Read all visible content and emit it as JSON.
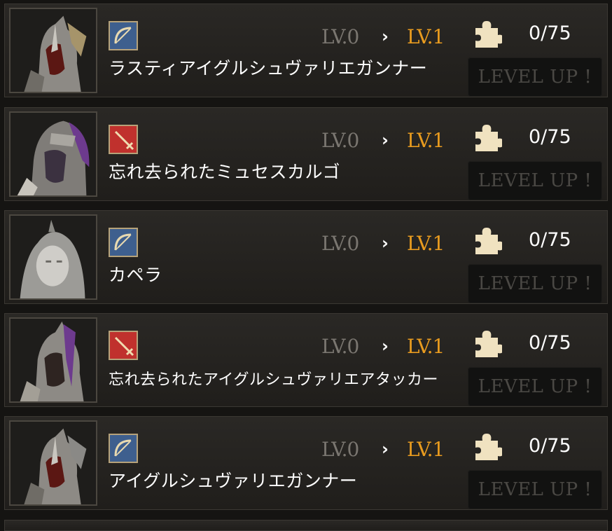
{
  "items": [
    {
      "name": "ラスティアイグルシュヴァリエガンナー",
      "class_icon": "bow-icon",
      "class_color": "#3e5f8e",
      "lv_from": "LV.0",
      "lv_to": "LV.1",
      "pieces": "0/75",
      "button": "LEVEL UP !"
    },
    {
      "name": "忘れ去られたミュセスカルゴ",
      "class_icon": "sword-icon",
      "class_color": "#c0312d",
      "lv_from": "LV.0",
      "lv_to": "LV.1",
      "pieces": "0/75",
      "button": "LEVEL UP !"
    },
    {
      "name": "カペラ",
      "class_icon": "bow-icon",
      "class_color": "#3e5f8e",
      "lv_from": "LV.0",
      "lv_to": "LV.1",
      "pieces": "0/75",
      "button": "LEVEL UP !"
    },
    {
      "name": "忘れ去られたアイグルシュヴァリエアタッカー",
      "class_icon": "sword-icon",
      "class_color": "#c0312d",
      "lv_from": "LV.0",
      "lv_to": "LV.1",
      "pieces": "0/75",
      "button": "LEVEL UP !"
    },
    {
      "name": "アイグルシュヴァリエガンナー",
      "class_icon": "bow-icon",
      "class_color": "#3e5f8e",
      "lv_from": "LV.0",
      "lv_to": "LV.1",
      "pieces": "0/75",
      "button": "LEVEL UP !"
    }
  ],
  "arrow_symbol": "›",
  "colors": {
    "target_level": "#e89b1f",
    "current_level": "#7a7670",
    "puzzle": "#f0e2c0"
  }
}
